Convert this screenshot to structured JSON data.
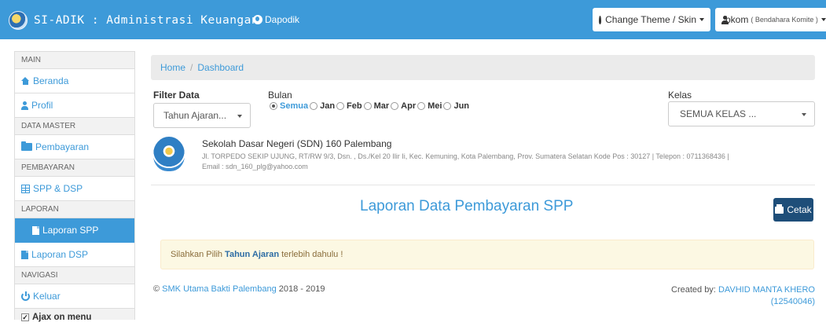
{
  "navbar": {
    "brand": "SI-ADIK : Administrasi Keuangan",
    "dapodik": "Dapodik",
    "theme_button": "Change Theme / Skin",
    "user_name": "bkom",
    "user_role": "( Bendahara Komite )",
    "accent_color": "#3d9ad9"
  },
  "sidebar": {
    "header_main": "MAIN",
    "beranda": "Beranda",
    "profil": "Profil",
    "header_master": "DATA MASTER",
    "pembayaran": "Pembayaran",
    "header_pembayaran": "PEMBAYARAN",
    "spp_dsp": "SPP & DSP",
    "header_laporan": "LAPORAN",
    "laporan_spp": "Laporan SPP",
    "laporan_dsp": "Laporan DSP",
    "header_navigasi": "NAVIGASI",
    "keluar": "Keluar",
    "ajax_label": "Ajax on menu",
    "ajax_checked": true,
    "active_item": "Laporan SPP"
  },
  "breadcrumb": {
    "home": "Home",
    "separator": "/",
    "current": "Dashboard"
  },
  "filter": {
    "label": "Filter Data",
    "tahun_ajaran": "Tahun Ajaran...",
    "bulan_label": "Bulan",
    "months": [
      "Semua",
      "Jan",
      "Feb",
      "Mar",
      "Apr",
      "Mei",
      "Jun"
    ],
    "selected_month": "Semua",
    "kelas_label": "Kelas",
    "kelas_value": "SEMUA KELAS ..."
  },
  "school": {
    "name": "Sekolah Dasar Negeri (SDN) 160 Palembang",
    "address": "Jl. TORPEDO SEKIP UJUNG, RT/RW 9/3, Dsn. , Ds./Kel 20 Ilir Ii, Kec. Kemuning, Kota Palembang, Prov. Sumatera Selatan Kode Pos : 30127 | Telepon : 0711368436 | Email : sdn_160_plg@yahoo.com"
  },
  "report": {
    "title": "Laporan Data Pembayaran SPP",
    "print_button": "Cetak"
  },
  "alert": {
    "prefix": "Silahkan Pilih",
    "bold": "Tahun Ajaran",
    "suffix": "terlebih dahulu !"
  },
  "footer": {
    "copyright_symbol": "©",
    "org": "SMK Utama Bakti Palembang",
    "years": "2018 - 2019",
    "created_by": "Created by:",
    "author": "DAVHID MANTA KHERO",
    "author_id": "(12540046)"
  }
}
